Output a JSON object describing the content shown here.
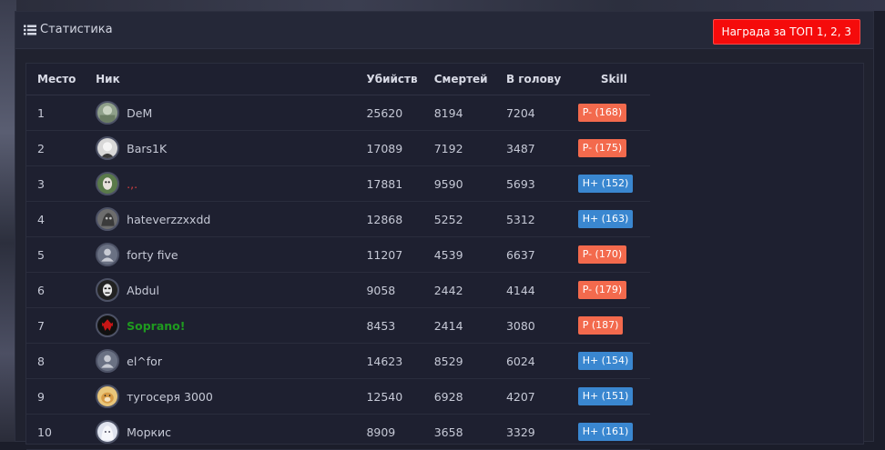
{
  "header": {
    "title": "Статистика",
    "award_button": "Награда за ТОП 1, 2, 3"
  },
  "table": {
    "columns": {
      "place": "Место",
      "nick": "Ник",
      "kills": "Убийств",
      "deaths": "Смертей",
      "headshots": "В голову",
      "skill": "Skill"
    },
    "rows": [
      {
        "place": "1",
        "nick": "DeM",
        "kills": "25620",
        "deaths": "8194",
        "headshots": "7204",
        "skill": "P- (168)",
        "skill_color": "#f36a4d"
      },
      {
        "place": "2",
        "nick": "Bars1K",
        "kills": "17089",
        "deaths": "7192",
        "headshots": "3487",
        "skill": "P- (175)",
        "skill_color": "#f36a4d"
      },
      {
        "place": "3",
        "nick": ".,.",
        "kills": "17881",
        "deaths": "9590",
        "headshots": "5693",
        "skill": "H+ (152)",
        "skill_color": "#3a87d0"
      },
      {
        "place": "4",
        "nick": "hateverzzxxdd",
        "kills": "12868",
        "deaths": "5252",
        "headshots": "5312",
        "skill": "H+ (163)",
        "skill_color": "#3a87d0"
      },
      {
        "place": "5",
        "nick": "forty five",
        "kills": "11207",
        "deaths": "4539",
        "headshots": "6637",
        "skill": "P- (170)",
        "skill_color": "#f36a4d"
      },
      {
        "place": "6",
        "nick": "Abdul",
        "kills": "9058",
        "deaths": "2442",
        "headshots": "4144",
        "skill": "P- (179)",
        "skill_color": "#f36a4d"
      },
      {
        "place": "7",
        "nick": "Soprano!",
        "kills": "8453",
        "deaths": "2414",
        "headshots": "3080",
        "skill": "P (187)",
        "skill_color": "#f36a4d"
      },
      {
        "place": "8",
        "nick": "el^for",
        "kills": "14623",
        "deaths": "8529",
        "headshots": "6024",
        "skill": "H+ (154)",
        "skill_color": "#3a87d0"
      },
      {
        "place": "9",
        "nick": "тугосеря 3000",
        "kills": "12540",
        "deaths": "6928",
        "headshots": "4207",
        "skill": "H+ (151)",
        "skill_color": "#3a87d0"
      },
      {
        "place": "10",
        "nick": "Моркис",
        "kills": "8909",
        "deaths": "3658",
        "headshots": "3329",
        "skill": "H+ (161)",
        "skill_color": "#3a87d0"
      }
    ]
  },
  "colors": {
    "award_button": "#f50b0b",
    "skill_orange": "#f36a4d",
    "skill_blue": "#3a87d0",
    "nick_highlight": "#1f9b1f"
  }
}
